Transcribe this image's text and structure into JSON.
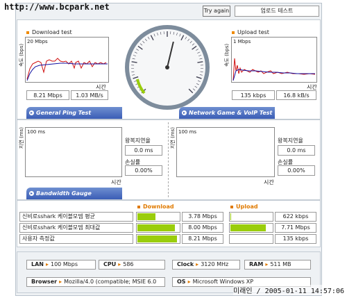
{
  "watermark_top": "http://www.bcpark.net",
  "watermark_bottom": "미래인 / 2005-01-11 14:57:06",
  "header": {
    "try_again": "Try again",
    "upload_test": "업로드 테스트"
  },
  "download": {
    "title": "Download test",
    "y_axis": "속도 (bps)",
    "scale": "20 Mbps",
    "time_label": "시간",
    "speed_bps": "8.21 Mbps",
    "speed_bytes": "1.03 MB/s"
  },
  "upload": {
    "title": "Upload test",
    "y_axis": "속도 (bps)",
    "scale": "1 Mbps",
    "time_label": "시간",
    "speed_bps": "135 kbps",
    "speed_bytes": "16.8 kB/s"
  },
  "tabs": {
    "ping": "General Ping Test",
    "game": "Network Game & VoIP Test",
    "gauge": "Bandwidth Gauge"
  },
  "ping_left": {
    "y_axis": "지연 (ms)",
    "scale": "100 ms",
    "time_label": "시간",
    "rtt_label": "왕복지연율",
    "rtt_value": "0.0 ms",
    "loss_label": "손실률",
    "loss_value": "0.00%"
  },
  "ping_right": {
    "y_axis": "지연 (ms)",
    "scale": "100 ms",
    "time_label": "시간",
    "rtt_label": "왕복지연율",
    "rtt_value": "0.0 ms",
    "loss_label": "손실률",
    "loss_value": "0.00%"
  },
  "gauge": {
    "download_header": "Download",
    "upload_header": "Upload",
    "rows": [
      {
        "label": "신비로sshark 케이블모뎀 평균",
        "dl_value": "3.78 Mbps",
        "dl_fill": 0.45,
        "ul_value": "622 kbps",
        "ul_fill": 0.05
      },
      {
        "label": "신비로sshark 케이블모뎀 최대값",
        "dl_value": "8.00 Mbps",
        "dl_fill": 0.9,
        "ul_value": "7.71 Mbps",
        "ul_fill": 0.85
      },
      {
        "label": "사용자 측정값",
        "dl_value": "8.21 Mbps",
        "dl_fill": 0.95,
        "ul_value": "135 kbps",
        "ul_fill": 0.02
      }
    ]
  },
  "system": {
    "lan_label": "LAN",
    "lan_value": "100 Mbps",
    "cpu_label": "CPU",
    "cpu_value": "586",
    "clock_label": "Clock",
    "clock_value": "3120 MHz",
    "ram_label": "RAM",
    "ram_value": "511 MB",
    "browser_label": "Browser",
    "browser_value": "Mozilla/4.0 (compatible; MSIE 6.0",
    "os_label": "OS",
    "os_value": "Microsoft Windows XP"
  },
  "speedometer": {
    "needle_fraction": 0.55
  },
  "colors": {
    "accent": "#3a5db6",
    "bar": "#9acd0c",
    "orange": "#e07a00",
    "series_red": "#d01010",
    "series_blue": "#1010a0"
  }
}
